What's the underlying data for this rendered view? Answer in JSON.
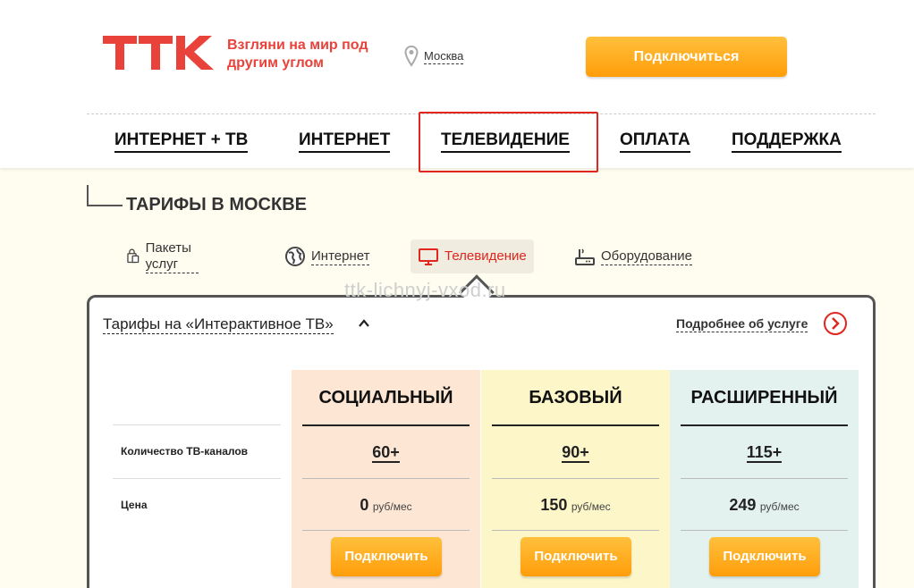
{
  "header": {
    "slogan": "Взгляни на мир под другим углом",
    "city": "Москва",
    "connect_label": "Подключиться",
    "brand_color": "#e8423a",
    "accent_color": "#ff9d0a"
  },
  "nav": {
    "items": [
      {
        "label": "ИНТЕРНЕТ + ТВ"
      },
      {
        "label": "ИНТЕРНЕТ"
      },
      {
        "label": "ТЕЛЕВИДЕНИЕ"
      },
      {
        "label": "ОПЛАТА"
      },
      {
        "label": "ПОДДЕРЖКА"
      }
    ],
    "highlighted": "ТЕЛЕВИДЕНИЕ",
    "highlight_color": "#e0261e"
  },
  "section": {
    "title": "ТАРИФЫ В МОСКВЕ"
  },
  "tabs": [
    {
      "label": "Пакеты услуг",
      "icon": "bag-icon"
    },
    {
      "label": "Интернет",
      "icon": "globe-icon"
    },
    {
      "label": "Телевидение",
      "icon": "tv-icon",
      "active": true
    },
    {
      "label": "Оборудование",
      "icon": "router-icon"
    }
  ],
  "watermark": "ttk-lichnyj-vxod.ru",
  "panel": {
    "title": "Тарифы на «Интерактивное ТВ»",
    "more_link": "Подробнее об услуге",
    "row_labels": {
      "channels": "Количество ТВ-каналов",
      "price": "Цена"
    },
    "plans": [
      {
        "name": "СОЦИАЛЬНЫЙ",
        "channels": "60+",
        "price": "0",
        "unit": "руб/мес",
        "button": "Подключить",
        "bg": "#fde6d4"
      },
      {
        "name": "БАЗОВЫЙ",
        "channels": "90+",
        "price": "150",
        "unit": "руб/мес",
        "button": "Подключить",
        "bg": "#fdf6c8"
      },
      {
        "name": "РАСШИРЕННЫЙ",
        "channels": "115+",
        "price": "249",
        "unit": "руб/мес",
        "button": "Подключить",
        "bg": "#e3f1ef"
      }
    ]
  }
}
